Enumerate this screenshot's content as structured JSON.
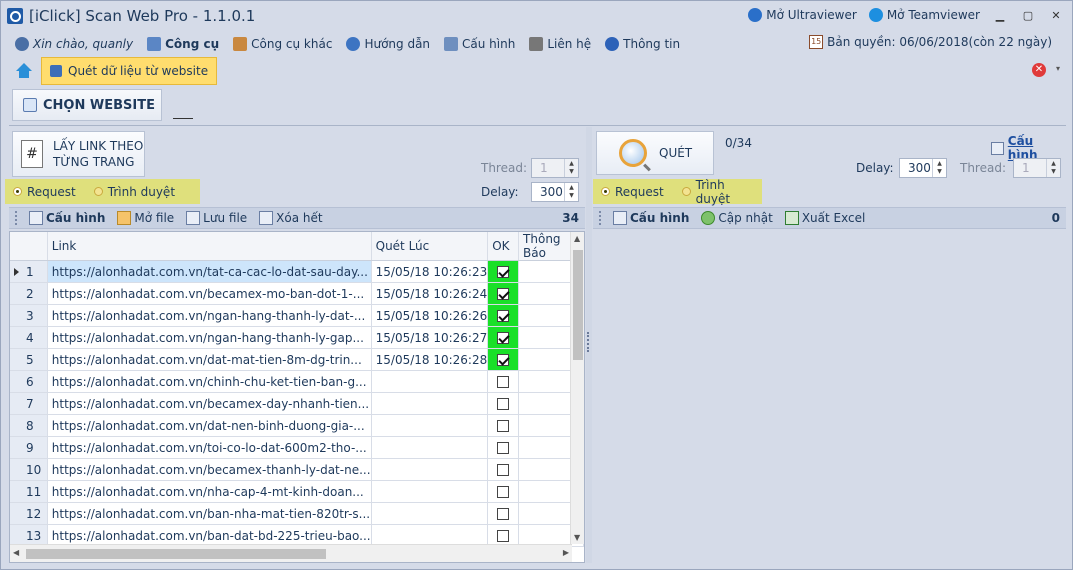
{
  "window": {
    "title": "[iClick] Scan Web Pro - 1.1.0.1",
    "ultraviewer": "Mở Ultraviewer",
    "teamviewer": "Mở Teamviewer",
    "min": "▁",
    "max": "▢",
    "close": "✕"
  },
  "menu": {
    "greeting": "Xin chào, quanly",
    "tools": "Công cụ",
    "other_tools": "Công cụ khác",
    "guide": "Hướng dẫn",
    "config": "Cấu hình",
    "contact": "Liên hệ",
    "info": "Thông tin",
    "license": "Bản quyền: 06/06/2018(còn 22 ngày)",
    "cal_day": "15"
  },
  "tabs": {
    "active": "Quét dữ liệu từ website",
    "close": "✕",
    "dropdown": "▾"
  },
  "toolbar_top": {
    "choose_website": "CHỌN WEBSITE"
  },
  "left": {
    "get_links_line1": "LẤY LINK THEO",
    "get_links_line2": "TỪNG TRANG",
    "doc_glyph": "#",
    "radio_request": "Request",
    "radio_browser": "Trình duyệt",
    "thread_label": "Thread:",
    "thread_value": "1",
    "delay_label": "Delay:",
    "delay_value": "300",
    "tb_config": "Cấu hình",
    "tb_open": "Mở file",
    "tb_save": "Lưu file",
    "tb_delete": "Xóa hết",
    "count": "34",
    "columns": [
      "Link",
      "Quét Lúc",
      "OK",
      "Thông Báo"
    ],
    "rows": [
      {
        "n": "1",
        "link": "https://alonhadat.com.vn/tat-ca-cac-lo-dat-sau-day...",
        "time": "15/05/18 10:26:23",
        "ok": true
      },
      {
        "n": "2",
        "link": "https://alonhadat.com.vn/becamex-mo-ban-dot-1-...",
        "time": "15/05/18 10:26:24",
        "ok": true
      },
      {
        "n": "3",
        "link": "https://alonhadat.com.vn/ngan-hang-thanh-ly-dat-...",
        "time": "15/05/18 10:26:26",
        "ok": true
      },
      {
        "n": "4",
        "link": "https://alonhadat.com.vn/ngan-hang-thanh-ly-gap...",
        "time": "15/05/18 10:26:27",
        "ok": true
      },
      {
        "n": "5",
        "link": "https://alonhadat.com.vn/dat-mat-tien-8m-dg-trin...",
        "time": "15/05/18 10:26:28",
        "ok": true
      },
      {
        "n": "6",
        "link": "https://alonhadat.com.vn/chinh-chu-ket-tien-ban-g...",
        "time": "",
        "ok": false
      },
      {
        "n": "7",
        "link": "https://alonhadat.com.vn/becamex-day-nhanh-tien...",
        "time": "",
        "ok": false
      },
      {
        "n": "8",
        "link": "https://alonhadat.com.vn/dat-nen-binh-duong-gia-...",
        "time": "",
        "ok": false
      },
      {
        "n": "9",
        "link": "https://alonhadat.com.vn/toi-co-lo-dat-600m2-tho-...",
        "time": "",
        "ok": false
      },
      {
        "n": "10",
        "link": "https://alonhadat.com.vn/becamex-thanh-ly-dat-ne...",
        "time": "",
        "ok": false
      },
      {
        "n": "11",
        "link": "https://alonhadat.com.vn/nha-cap-4-mt-kinh-doan...",
        "time": "",
        "ok": false
      },
      {
        "n": "12",
        "link": "https://alonhadat.com.vn/ban-nha-mat-tien-820tr-s...",
        "time": "",
        "ok": false
      },
      {
        "n": "13",
        "link": "https://alonhadat.com.vn/ban-dat-bd-225-trieu-bao...",
        "time": "",
        "ok": false
      }
    ]
  },
  "right": {
    "scan_label": "QUÉT",
    "progress": "0/34",
    "config_link": "Cấu hình",
    "delay_label": "Delay:",
    "delay_value": "300",
    "thread_label": "Thread:",
    "thread_value": "1",
    "radio_request": "Request",
    "radio_browser": "Trình duyệt",
    "tb_config": "Cấu hình",
    "tb_update": "Cập nhật",
    "tb_export": "Xuất Excel",
    "count": "0"
  },
  "colors": {
    "ok_green": "#19e028",
    "radio_band": "#dfe07c",
    "active_tab": "#ffdd6e",
    "selected_cell": "#cde5fb"
  }
}
